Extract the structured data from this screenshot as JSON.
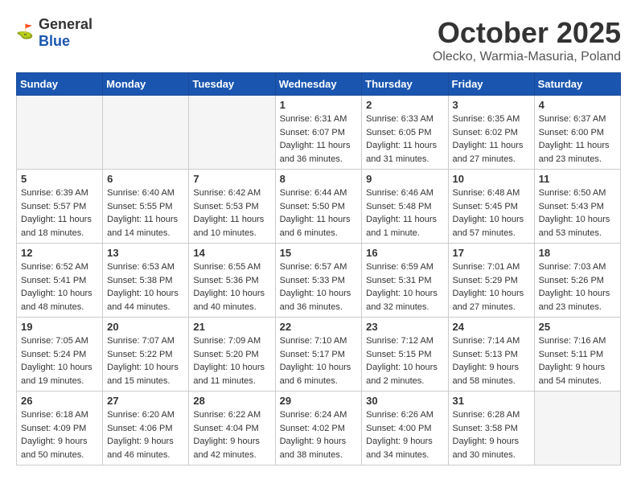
{
  "logo": {
    "general": "General",
    "blue": "Blue"
  },
  "title": "October 2025",
  "subtitle": "Olecko, Warmia-Masuria, Poland",
  "days_header": [
    "Sunday",
    "Monday",
    "Tuesday",
    "Wednesday",
    "Thursday",
    "Friday",
    "Saturday"
  ],
  "weeks": [
    [
      {
        "day": "",
        "info": ""
      },
      {
        "day": "",
        "info": ""
      },
      {
        "day": "",
        "info": ""
      },
      {
        "day": "1",
        "info": "Sunrise: 6:31 AM\nSunset: 6:07 PM\nDaylight: 11 hours\nand 36 minutes."
      },
      {
        "day": "2",
        "info": "Sunrise: 6:33 AM\nSunset: 6:05 PM\nDaylight: 11 hours\nand 31 minutes."
      },
      {
        "day": "3",
        "info": "Sunrise: 6:35 AM\nSunset: 6:02 PM\nDaylight: 11 hours\nand 27 minutes."
      },
      {
        "day": "4",
        "info": "Sunrise: 6:37 AM\nSunset: 6:00 PM\nDaylight: 11 hours\nand 23 minutes."
      }
    ],
    [
      {
        "day": "5",
        "info": "Sunrise: 6:39 AM\nSunset: 5:57 PM\nDaylight: 11 hours\nand 18 minutes."
      },
      {
        "day": "6",
        "info": "Sunrise: 6:40 AM\nSunset: 5:55 PM\nDaylight: 11 hours\nand 14 minutes."
      },
      {
        "day": "7",
        "info": "Sunrise: 6:42 AM\nSunset: 5:53 PM\nDaylight: 11 hours\nand 10 minutes."
      },
      {
        "day": "8",
        "info": "Sunrise: 6:44 AM\nSunset: 5:50 PM\nDaylight: 11 hours\nand 6 minutes."
      },
      {
        "day": "9",
        "info": "Sunrise: 6:46 AM\nSunset: 5:48 PM\nDaylight: 11 hours\nand 1 minute."
      },
      {
        "day": "10",
        "info": "Sunrise: 6:48 AM\nSunset: 5:45 PM\nDaylight: 10 hours\nand 57 minutes."
      },
      {
        "day": "11",
        "info": "Sunrise: 6:50 AM\nSunset: 5:43 PM\nDaylight: 10 hours\nand 53 minutes."
      }
    ],
    [
      {
        "day": "12",
        "info": "Sunrise: 6:52 AM\nSunset: 5:41 PM\nDaylight: 10 hours\nand 48 minutes."
      },
      {
        "day": "13",
        "info": "Sunrise: 6:53 AM\nSunset: 5:38 PM\nDaylight: 10 hours\nand 44 minutes."
      },
      {
        "day": "14",
        "info": "Sunrise: 6:55 AM\nSunset: 5:36 PM\nDaylight: 10 hours\nand 40 minutes."
      },
      {
        "day": "15",
        "info": "Sunrise: 6:57 AM\nSunset: 5:33 PM\nDaylight: 10 hours\nand 36 minutes."
      },
      {
        "day": "16",
        "info": "Sunrise: 6:59 AM\nSunset: 5:31 PM\nDaylight: 10 hours\nand 32 minutes."
      },
      {
        "day": "17",
        "info": "Sunrise: 7:01 AM\nSunset: 5:29 PM\nDaylight: 10 hours\nand 27 minutes."
      },
      {
        "day": "18",
        "info": "Sunrise: 7:03 AM\nSunset: 5:26 PM\nDaylight: 10 hours\nand 23 minutes."
      }
    ],
    [
      {
        "day": "19",
        "info": "Sunrise: 7:05 AM\nSunset: 5:24 PM\nDaylight: 10 hours\nand 19 minutes."
      },
      {
        "day": "20",
        "info": "Sunrise: 7:07 AM\nSunset: 5:22 PM\nDaylight: 10 hours\nand 15 minutes."
      },
      {
        "day": "21",
        "info": "Sunrise: 7:09 AM\nSunset: 5:20 PM\nDaylight: 10 hours\nand 11 minutes."
      },
      {
        "day": "22",
        "info": "Sunrise: 7:10 AM\nSunset: 5:17 PM\nDaylight: 10 hours\nand 6 minutes."
      },
      {
        "day": "23",
        "info": "Sunrise: 7:12 AM\nSunset: 5:15 PM\nDaylight: 10 hours\nand 2 minutes."
      },
      {
        "day": "24",
        "info": "Sunrise: 7:14 AM\nSunset: 5:13 PM\nDaylight: 9 hours\nand 58 minutes."
      },
      {
        "day": "25",
        "info": "Sunrise: 7:16 AM\nSunset: 5:11 PM\nDaylight: 9 hours\nand 54 minutes."
      }
    ],
    [
      {
        "day": "26",
        "info": "Sunrise: 6:18 AM\nSunset: 4:09 PM\nDaylight: 9 hours\nand 50 minutes."
      },
      {
        "day": "27",
        "info": "Sunrise: 6:20 AM\nSunset: 4:06 PM\nDaylight: 9 hours\nand 46 minutes."
      },
      {
        "day": "28",
        "info": "Sunrise: 6:22 AM\nSunset: 4:04 PM\nDaylight: 9 hours\nand 42 minutes."
      },
      {
        "day": "29",
        "info": "Sunrise: 6:24 AM\nSunset: 4:02 PM\nDaylight: 9 hours\nand 38 minutes."
      },
      {
        "day": "30",
        "info": "Sunrise: 6:26 AM\nSunset: 4:00 PM\nDaylight: 9 hours\nand 34 minutes."
      },
      {
        "day": "31",
        "info": "Sunrise: 6:28 AM\nSunset: 3:58 PM\nDaylight: 9 hours\nand 30 minutes."
      },
      {
        "day": "",
        "info": ""
      }
    ]
  ]
}
